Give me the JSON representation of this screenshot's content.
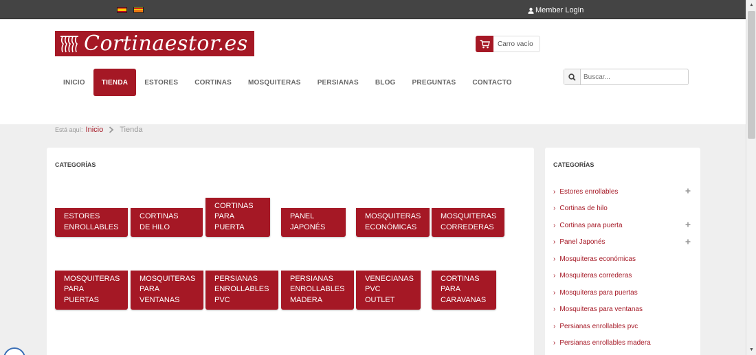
{
  "topbar": {
    "flags": [
      "es-flag-icon",
      "catalonia-flag-icon"
    ],
    "member_login": "Member Login"
  },
  "header": {
    "logo_text": "Cortinaestor.es",
    "cart_label": "Carro vacío",
    "search_placeholder": "Buscar..."
  },
  "nav": {
    "items": [
      {
        "label": "INICIO",
        "active": false
      },
      {
        "label": "TIENDA",
        "active": true
      },
      {
        "label": "ESTORES",
        "active": false
      },
      {
        "label": "CORTINAS",
        "active": false
      },
      {
        "label": "MOSQUITERAS",
        "active": false
      },
      {
        "label": "PERSIANAS",
        "active": false
      },
      {
        "label": "BLOG",
        "active": false
      },
      {
        "label": "PREGUNTAS",
        "active": false
      },
      {
        "label": "CONTACTO",
        "active": false
      }
    ]
  },
  "breadcrumb": {
    "label": "Está aquí:",
    "home": "Inicio",
    "current": "Tienda"
  },
  "main": {
    "title": "CATEGORÍAS",
    "categories": [
      "ESTORES\nENROLLABLES",
      "CORTINAS\nDE HILO",
      "CORTINAS\nPARA\nPUERTA",
      "PANEL\nJAPONÉS",
      "MOSQUITERAS\nECONÓMICAS",
      "MOSQUITERAS\nCORREDERAS",
      "MOSQUITERAS\nPARA\nPUERTAS",
      "MOSQUITERAS\nPARA\nVENTANAS",
      "PERSIANAS\nENROLLABLES\nPVC",
      "PERSIANAS\nENROLLABLES\nMADERA",
      "VENECIANAS\nPVC\nOUTLET",
      "CORTINAS\nPARA\nCARAVANAS"
    ]
  },
  "sidebar": {
    "title": "CATEGORÍAS",
    "items": [
      {
        "label": "Estores enrollables",
        "expandable": true
      },
      {
        "label": "Cortinas de hilo",
        "expandable": false
      },
      {
        "label": "Cortinas para puerta",
        "expandable": true
      },
      {
        "label": "Panel Japonés",
        "expandable": true
      },
      {
        "label": "Mosquiteras económicas",
        "expandable": false
      },
      {
        "label": "Mosquiteras correderas",
        "expandable": false
      },
      {
        "label": "Mosquiteras para puertas",
        "expandable": false
      },
      {
        "label": "Mosquiteras para ventanas",
        "expandable": false
      },
      {
        "label": "Persianas enrollables pvc",
        "expandable": false
      },
      {
        "label": "Persianas enrollables madera",
        "expandable": false
      }
    ]
  },
  "colors": {
    "brand": "#a51825",
    "topbar": "#444444",
    "page_bg": "#efefef"
  }
}
